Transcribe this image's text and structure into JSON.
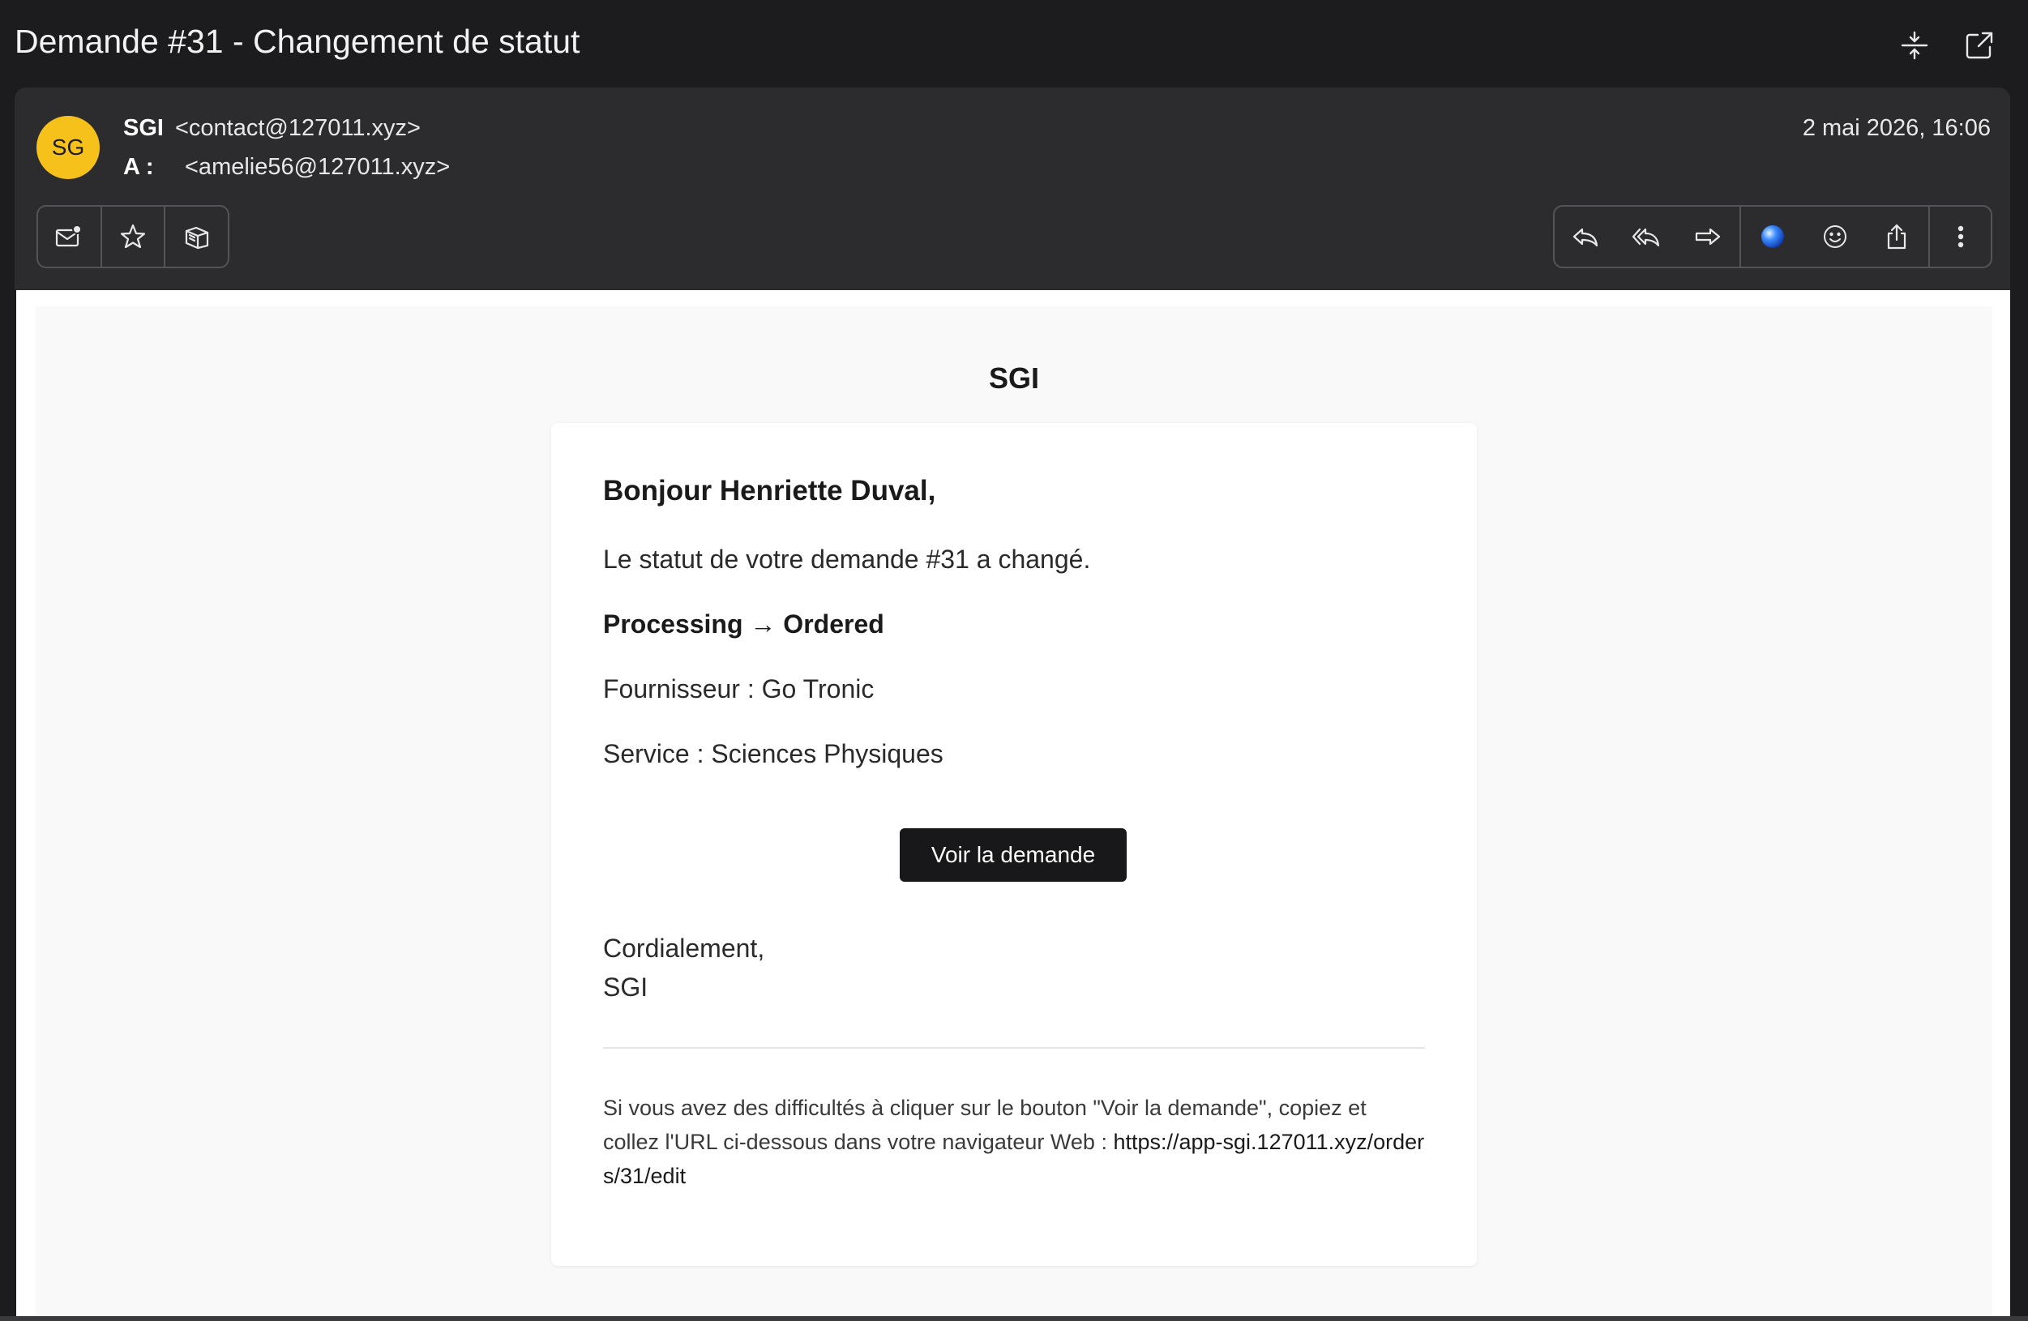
{
  "window": {
    "subject": "Demande #31 - Changement de statut"
  },
  "header": {
    "avatar_initials": "SG",
    "avatar_color": "#f7c11b",
    "sender_name": "SGI",
    "sender_email": "<contact@127011.xyz>",
    "to_label": "A :",
    "recipient_email": "<amelie56@127011.xyz>",
    "date": "2 mai 2026, 16:06"
  },
  "toolbar": {
    "left": [
      {
        "icon": "mark-unread-icon"
      },
      {
        "icon": "star-icon"
      },
      {
        "icon": "archive-icon"
      }
    ],
    "right": [
      {
        "icon": "reply-icon"
      },
      {
        "icon": "reply-all-icon"
      },
      {
        "icon": "forward-icon"
      },
      {
        "icon": "ai-orb-icon"
      },
      {
        "icon": "emoji-icon"
      },
      {
        "icon": "share-icon"
      },
      {
        "icon": "more-icon"
      }
    ]
  },
  "email": {
    "brand": "SGI",
    "greeting": "Bonjour Henriette Duval,",
    "line1": "Le statut de votre demande #31 a changé.",
    "status_change": "Processing → Ordered",
    "supplier": "Fournisseur : Go Tronic",
    "service": "Service : Sciences Physiques",
    "cta_label": "Voir la demande",
    "regards": "Cordialement,",
    "signoff": "SGI",
    "footer_text": "Si vous avez des difficultés à cliquer sur le bouton \"Voir la demande\", copiez et collez l'URL ci-dessous dans votre navigateur Web : ",
    "footer_url": "https://app-sgi.127011.xyz/orders/31/edit"
  },
  "colors": {
    "background": "#1c1c1e",
    "header_panel": "#2c2c2e",
    "accent_button": "#18181b"
  }
}
